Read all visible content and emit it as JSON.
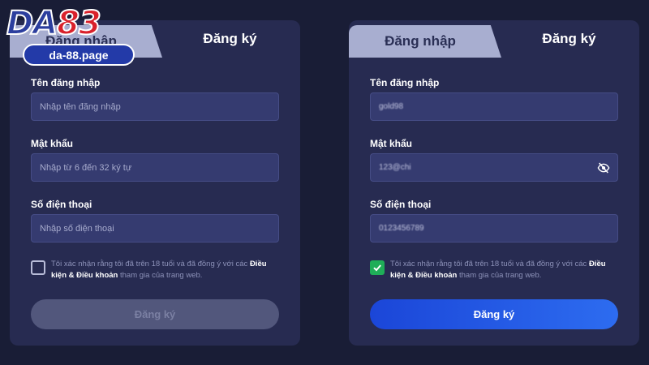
{
  "logo": {
    "brand_da": "DA",
    "brand_num": "83",
    "domain": "da-88.page"
  },
  "left": {
    "tab_login": "Đăng nhập",
    "tab_register": "Đăng ký",
    "username_label": "Tên đăng nhập",
    "username_placeholder": "Nhập tên đăng nhập",
    "password_label": "Mật khẩu",
    "password_placeholder": "Nhập từ 6 đến 32 ký tự",
    "phone_label": "Số điện thoại",
    "phone_placeholder": "Nhập số điện thoại",
    "consent_prefix": "Tôi xác nhận rằng tôi đã trên 18 tuổi và đã đồng ý với các ",
    "consent_terms": "Điều kiện & Điều khoản",
    "consent_suffix": " tham gia của trang web.",
    "agreed": false,
    "submit_label": "Đăng ký"
  },
  "right": {
    "tab_login": "Đăng nhập",
    "tab_register": "Đăng ký",
    "username_label": "Tên đăng nhập",
    "username_value": "gold98",
    "password_label": "Mật khẩu",
    "password_value": "123@chi",
    "phone_label": "Số điện thoại",
    "phone_value": "0123456789",
    "consent_prefix": "Tôi xác nhận rằng tôi đã trên 18 tuổi và đã đồng ý với các ",
    "consent_terms": "Điều kiện & Điều khoản",
    "consent_suffix": " tham gia của trang web.",
    "agreed": true,
    "submit_label": "Đăng ký"
  },
  "icons": {
    "eye": "eye-slash-icon",
    "check": "check-icon"
  },
  "colors": {
    "background": "#191d36",
    "panel": "#272b51",
    "accent_blue": "#1b46d8",
    "checkbox_green": "#1fae58",
    "brand_red": "#d9212b"
  }
}
